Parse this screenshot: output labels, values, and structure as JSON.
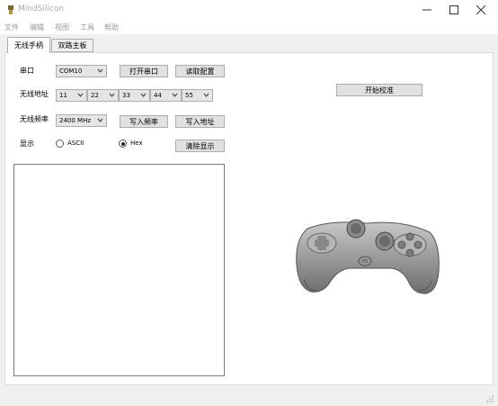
{
  "window": {
    "title": "MindSilicon"
  },
  "menu": [
    "文件",
    "编辑",
    "视图",
    "工具",
    "帮助"
  ],
  "tabs": [
    "无线手柄",
    "双路主板"
  ],
  "serial": {
    "label": "串口",
    "port": "COM10",
    "open_button": "打开串口",
    "read_button": "读取配置"
  },
  "address": {
    "label": "无线地址",
    "values": [
      "11",
      "22",
      "33",
      "44",
      "55"
    ]
  },
  "frequency": {
    "label": "无线频率",
    "value": "2400 MHz",
    "write_freq_button": "写入频率",
    "write_addr_button": "写入地址"
  },
  "display": {
    "label": "显示",
    "options": [
      "ASCII",
      "Hex"
    ],
    "selected": "Hex",
    "clear_button": "清除显示"
  },
  "calibrate_button": "开始校准",
  "gamepad": {
    "center_text": "PS"
  },
  "colors": {
    "accent": "#2a2a2a",
    "button_bg": "#e1e1e1",
    "border": "#adadad"
  }
}
